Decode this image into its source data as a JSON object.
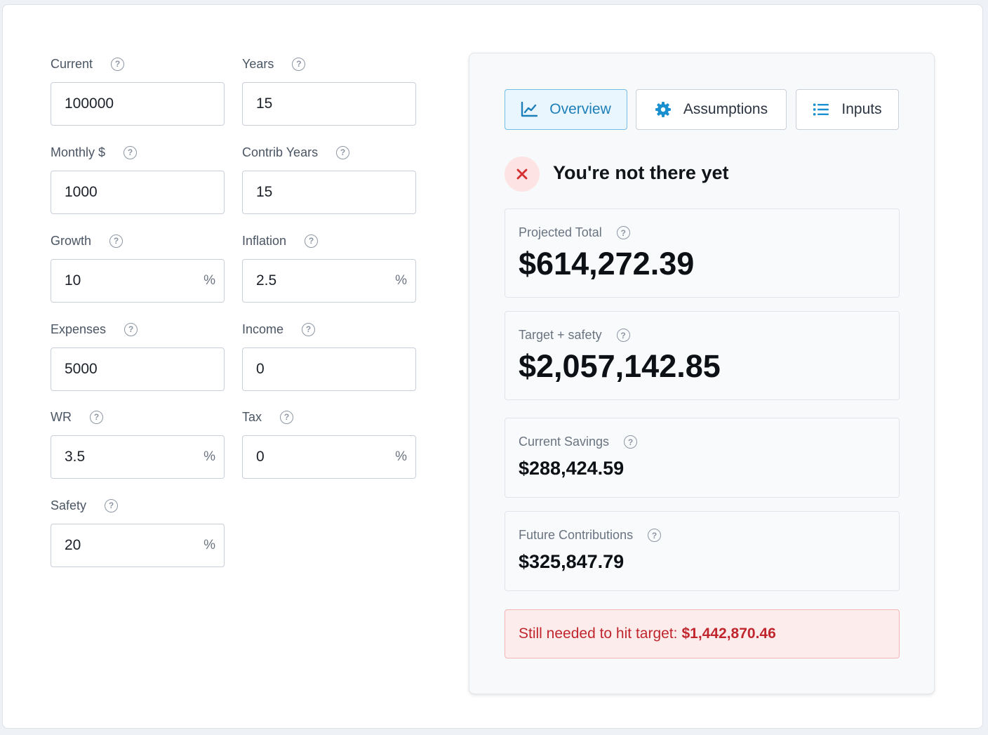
{
  "form": {
    "current": {
      "label": "Current",
      "value": "100000",
      "suffix": ""
    },
    "years": {
      "label": "Years",
      "value": "15",
      "suffix": ""
    },
    "monthly": {
      "label": "Monthly $",
      "value": "1000",
      "suffix": ""
    },
    "contrib_years": {
      "label": "Contrib Years",
      "value": "15",
      "suffix": ""
    },
    "growth": {
      "label": "Growth",
      "value": "10",
      "suffix": "%"
    },
    "inflation": {
      "label": "Inflation",
      "value": "2.5",
      "suffix": "%"
    },
    "expenses": {
      "label": "Expenses",
      "value": "5000",
      "suffix": ""
    },
    "income": {
      "label": "Income",
      "value": "0",
      "suffix": ""
    },
    "wr": {
      "label": "WR",
      "value": "3.5",
      "suffix": "%"
    },
    "tax": {
      "label": "Tax",
      "value": "0",
      "suffix": "%"
    },
    "safety": {
      "label": "Safety",
      "value": "20",
      "suffix": "%"
    }
  },
  "help_glyph": "?",
  "tabs": {
    "overview": {
      "label": "Overview",
      "icon": "line-chart-icon",
      "active": true
    },
    "assumptions": {
      "label": "Assumptions",
      "icon": "gear-icon",
      "active": false
    },
    "inputs": {
      "label": "Inputs",
      "icon": "list-icon",
      "active": false
    }
  },
  "status": {
    "text": "You're not there yet",
    "icon": "close-icon",
    "color": "#d32f2f"
  },
  "stats": {
    "projected_total": {
      "label": "Projected Total",
      "value": "$614,272.39"
    },
    "target_safety": {
      "label": "Target + safety",
      "value": "$2,057,142.85"
    },
    "current_savings": {
      "label": "Current Savings",
      "value": "$288,424.59"
    },
    "future_contributions": {
      "label": "Future Contributions",
      "value": "$325,847.79"
    }
  },
  "alert": {
    "text": "Still needed to hit target:",
    "amount": "$1,442,870.46"
  },
  "colors": {
    "accent": "#1d7fb8",
    "danger": "#c0262d",
    "danger_bg": "#fdecec"
  }
}
